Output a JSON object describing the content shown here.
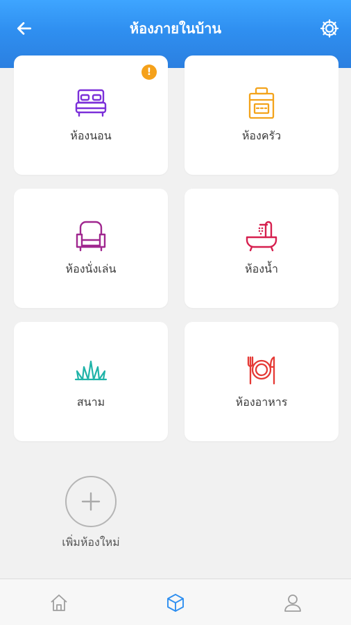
{
  "header": {
    "title": "ห้องภายในบ้าน",
    "back_icon": "arrow-left-icon",
    "settings_icon": "gear-icon"
  },
  "rooms": [
    {
      "label": "ห้องนอน",
      "icon": "bed-icon",
      "color": "#7b2fd9",
      "badge": "!"
    },
    {
      "label": "ห้องครัว",
      "icon": "stove-icon",
      "color": "#f3a31b"
    },
    {
      "label": "ห้องนั่งเล่น",
      "icon": "armchair-icon",
      "color": "#a0278f"
    },
    {
      "label": "ห้องน้ำ",
      "icon": "bathtub-icon",
      "color": "#d61f4e"
    },
    {
      "label": "สนาม",
      "icon": "grass-icon",
      "color": "#1fb3a8"
    },
    {
      "label": "ห้องอาหาร",
      "icon": "plate-cutlery-icon",
      "color": "#e53935"
    }
  ],
  "add_room": {
    "label": "เพิ่มห้องใหม่",
    "icon": "plus-icon"
  },
  "colors": {
    "header": "#2f8ff0",
    "badge": "#f5a11a",
    "active_tab": "#2f8ff0",
    "inactive_tab": "#9e9e9e"
  },
  "tabbar": [
    {
      "icon": "home-icon",
      "active": false
    },
    {
      "icon": "cube-icon",
      "active": true
    },
    {
      "icon": "user-icon",
      "active": false
    }
  ]
}
